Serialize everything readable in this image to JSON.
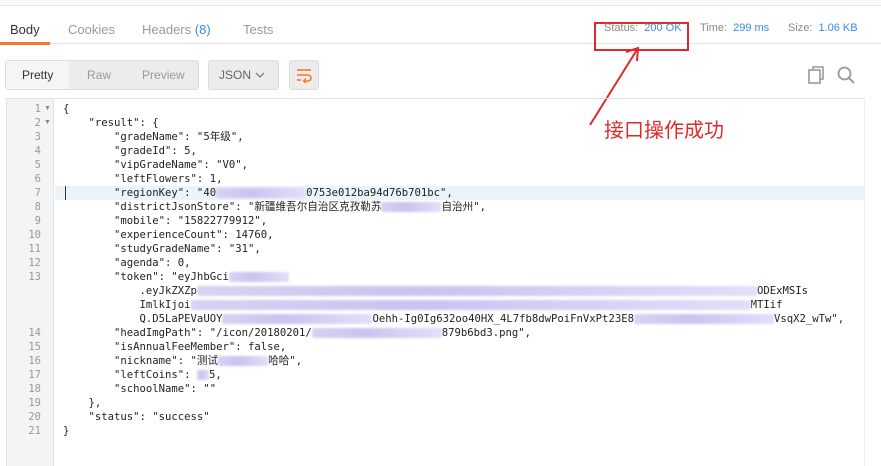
{
  "tabs": [
    {
      "label": "Body",
      "active": true
    },
    {
      "label": "Cookies"
    },
    {
      "label": "Headers",
      "count": "(8)"
    },
    {
      "label": "Tests"
    }
  ],
  "meta": {
    "status_label": "Status:",
    "status_value": "200 OK",
    "time_label": "Time:",
    "time_value": "299 ms",
    "size_label": "Size:",
    "size_value": "1.06 KB"
  },
  "toolbar": {
    "views": [
      "Pretty",
      "Raw",
      "Preview"
    ],
    "active_view": "Pretty",
    "format": "JSON"
  },
  "annotation": "接口操作成功",
  "colors": {
    "accent": "#f37a2a",
    "link": "#3a8de0",
    "annotation": "#e02a2a",
    "highlight_line": "#ebf3fb"
  },
  "code": {
    "highlight_line": 7,
    "lines": [
      {
        "n": "1",
        "fold": true,
        "text": "{"
      },
      {
        "n": "2",
        "fold": true,
        "text": "    \"result\": {"
      },
      {
        "n": "3",
        "text": "        \"gradeName\": \"5年级\","
      },
      {
        "n": "4",
        "text": "        \"gradeId\": 5,"
      },
      {
        "n": "5",
        "text": "        \"vipGradeName\": \"V0\","
      },
      {
        "n": "6",
        "text": "        \"leftFlowers\": 1,"
      },
      {
        "n": "7",
        "text": "        \"regionKey\": \"40",
        "blur": 90,
        "tail": "0753e012ba94d76b701bc\","
      },
      {
        "n": "8",
        "text": "        \"districtJsonStore\": \"新疆维吾尔自治区克孜勒苏",
        "blur": 60,
        "tail": "自治州\","
      },
      {
        "n": "9",
        "text": "        \"mobile\": \"15822779912\","
      },
      {
        "n": "10",
        "text": "        \"experienceCount\": 14760,"
      },
      {
        "n": "11",
        "text": "        \"studyGradeName\": \"31\","
      },
      {
        "n": "12",
        "text": "        \"agenda\": 0,"
      },
      {
        "n": "13",
        "text": "        \"token\": \"eyJhbGci",
        "blur": 60,
        "tail": ""
      },
      {
        "n": "",
        "text": "            .eyJkZXZp",
        "blur": 560,
        "tail": "ODExMSIs"
      },
      {
        "n": "",
        "text": "            ImlkIjoi",
        "blur": 560,
        "tail": "MTIif"
      },
      {
        "n": "",
        "text": "            Q.D5LaPEVaUOY",
        "blur": 150,
        "tail": "Oehh-Ig0Ig632oo40HX_4L7fb8dwPoiFnVxPt23E8",
        "blur2": 140,
        "tail2": "VsqX2_wTw\","
      },
      {
        "n": "14",
        "text": "        \"headImgPath\": \"/icon/20180201/",
        "blur": 130,
        "tail": "879b6bd3.png\","
      },
      {
        "n": "15",
        "text": "        \"isAnnualFeeMember\": false,"
      },
      {
        "n": "16",
        "text": "        \"nickname\": \"测试",
        "blur": 50,
        "tail": "哈哈\","
      },
      {
        "n": "17",
        "text": "        \"leftCoins\": ",
        "blur": 12,
        "tail": "5,"
      },
      {
        "n": "18",
        "text": "        \"schoolName\": \"\""
      },
      {
        "n": "19",
        "text": "    },"
      },
      {
        "n": "20",
        "text": "    \"status\": \"success\""
      },
      {
        "n": "21",
        "text": "}"
      }
    ]
  }
}
